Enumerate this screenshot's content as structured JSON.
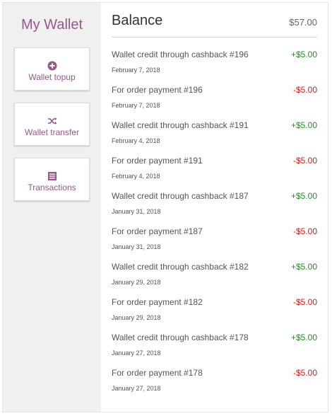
{
  "sidebar": {
    "title": "My Wallet",
    "items": [
      {
        "label": "Wallet topup",
        "icon": "plus-circle-icon"
      },
      {
        "label": "Wallet transfer",
        "icon": "shuffle-icon"
      },
      {
        "label": "Transactions",
        "icon": "list-icon"
      }
    ]
  },
  "main": {
    "balance_label": "Balance",
    "balance_amount": "$57.00",
    "transactions": [
      {
        "description": "Wallet credit through cashback #196",
        "date": "February 7, 2018",
        "amount": "+$5.00",
        "type": "credit"
      },
      {
        "description": "For order payment #196",
        "date": "February 7, 2018",
        "amount": "-$5.00",
        "type": "debit"
      },
      {
        "description": "Wallet credit through cashback #191",
        "date": "February 4, 2018",
        "amount": "+$5.00",
        "type": "credit"
      },
      {
        "description": "For order payment #191",
        "date": "February 4, 2018",
        "amount": "-$5.00",
        "type": "debit"
      },
      {
        "description": "Wallet credit through cashback #187",
        "date": "January 31, 2018",
        "amount": "+$5.00",
        "type": "credit"
      },
      {
        "description": "For order payment #187",
        "date": "January 31, 2018",
        "amount": "-$5.00",
        "type": "debit"
      },
      {
        "description": "Wallet credit through cashback #182",
        "date": "January 29, 2018",
        "amount": "+$5.00",
        "type": "credit"
      },
      {
        "description": "For order payment #182",
        "date": "January 29, 2018",
        "amount": "-$5.00",
        "type": "debit"
      },
      {
        "description": "Wallet credit through cashback #178",
        "date": "January 27, 2018",
        "amount": "+$5.00",
        "type": "credit"
      },
      {
        "description": "For order payment #178",
        "date": "January 27, 2018",
        "amount": "-$5.00",
        "type": "debit"
      }
    ]
  },
  "colors": {
    "accent": "#96588a",
    "credit": "#2a8a2a",
    "debit": "#c81f1f",
    "sidebar_bg": "#f0f0f0"
  }
}
